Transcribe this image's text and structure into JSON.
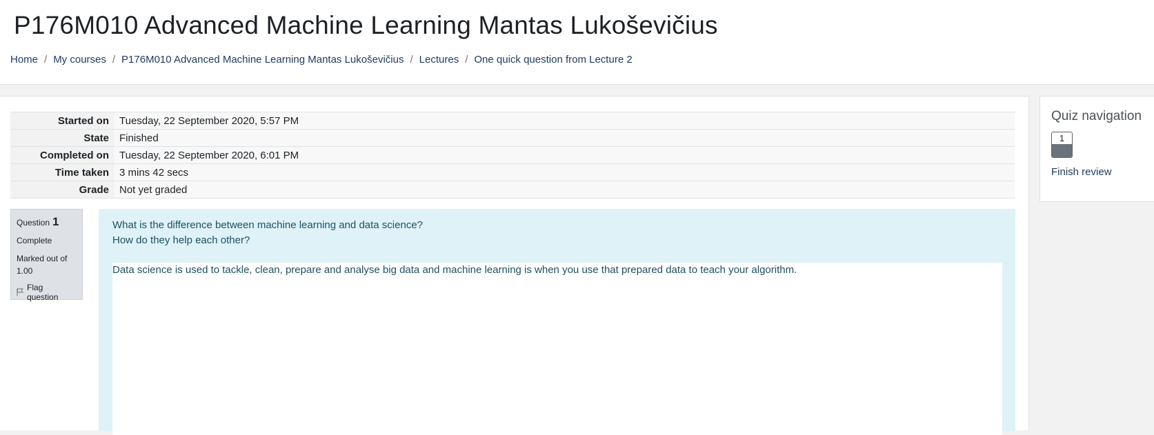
{
  "header": {
    "title": "P176M010 Advanced Machine Learning Mantas Lukoševičius",
    "breadcrumb": [
      {
        "label": "Home"
      },
      {
        "label": "My courses"
      },
      {
        "label": "P176M010 Advanced Machine Learning Mantas Lukoševičius"
      },
      {
        "label": "Lectures"
      },
      {
        "label": "One quick question from Lecture 2"
      }
    ],
    "separator": "/"
  },
  "summary": [
    {
      "label": "Started on",
      "value": "Tuesday, 22 September 2020, 5:57 PM"
    },
    {
      "label": "State",
      "value": "Finished"
    },
    {
      "label": "Completed on",
      "value": "Tuesday, 22 September 2020, 6:01 PM"
    },
    {
      "label": "Time taken",
      "value": "3 mins 42 secs"
    },
    {
      "label": "Grade",
      "value": "Not yet graded"
    }
  ],
  "question": {
    "label": "Question",
    "number": "1",
    "state": "Complete",
    "grade_label": "Marked out of",
    "grade_value": "1.00",
    "flag_label": "Flag question",
    "text_line1": "What is the difference between machine learning and data science?",
    "text_line2": "How do they help each other?",
    "answer": "Data science is used to tackle, clean, prepare and analyse big data and machine learning is when you use that prepared data to teach your algorithm."
  },
  "quiz_nav": {
    "title": "Quiz navigation",
    "buttons": [
      {
        "number": "1"
      }
    ],
    "finish_label": "Finish review"
  },
  "icons": {
    "flag": "flag-icon"
  },
  "colors": {
    "question_background": "#def2f8",
    "link": "#1d3a5f",
    "nav_status": "#6a737b"
  }
}
